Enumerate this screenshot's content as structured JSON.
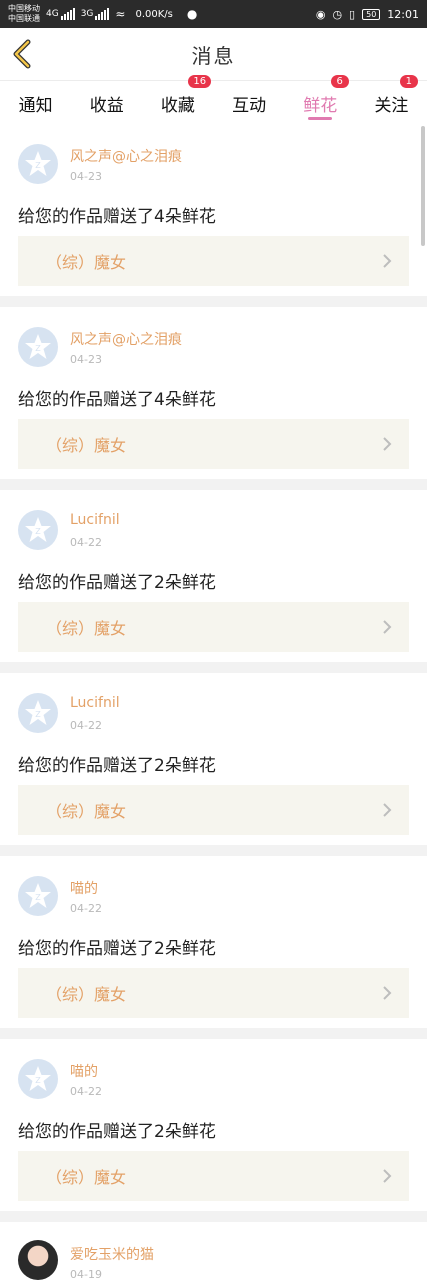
{
  "status_bar": {
    "carrier_1": "中国移动",
    "carrier_2": "中国联通",
    "net_1": "4G",
    "net_2": "3G",
    "speed": "0.00K/s",
    "battery": "50",
    "time": "12:01"
  },
  "header": {
    "title": "消息"
  },
  "tabs": [
    {
      "label": "通知",
      "badge": ""
    },
    {
      "label": "收益",
      "badge": ""
    },
    {
      "label": "收藏",
      "badge": "16"
    },
    {
      "label": "互动",
      "badge": ""
    },
    {
      "label": "鲜花",
      "badge": "6"
    },
    {
      "label": "关注",
      "badge": "1"
    }
  ],
  "active_tab": "鲜花",
  "messages": [
    {
      "user": "风之声@心之泪痕",
      "date": "04-23",
      "text": "给您的作品赠送了4朵鲜花",
      "work": "（综）魔女"
    },
    {
      "user": "风之声@心之泪痕",
      "date": "04-23",
      "text": "给您的作品赠送了4朵鲜花",
      "work": "（综）魔女"
    },
    {
      "user": "Lucifnil",
      "date": "04-22",
      "text": "给您的作品赠送了2朵鲜花",
      "work": "（综）魔女"
    },
    {
      "user": "Lucifnil",
      "date": "04-22",
      "text": "给您的作品赠送了2朵鲜花",
      "work": "（综）魔女"
    },
    {
      "user": "喵的",
      "date": "04-22",
      "text": "给您的作品赠送了2朵鲜花",
      "work": "（综）魔女"
    },
    {
      "user": "喵的",
      "date": "04-22",
      "text": "给您的作品赠送了2朵鲜花",
      "work": "（综）魔女"
    },
    {
      "user": "爱吃玉米的猫",
      "date": "04-19",
      "text": "",
      "work": ""
    }
  ],
  "colors": {
    "accent": "#e07ab0",
    "username": "#e3a167",
    "badge": "#e8344a"
  }
}
